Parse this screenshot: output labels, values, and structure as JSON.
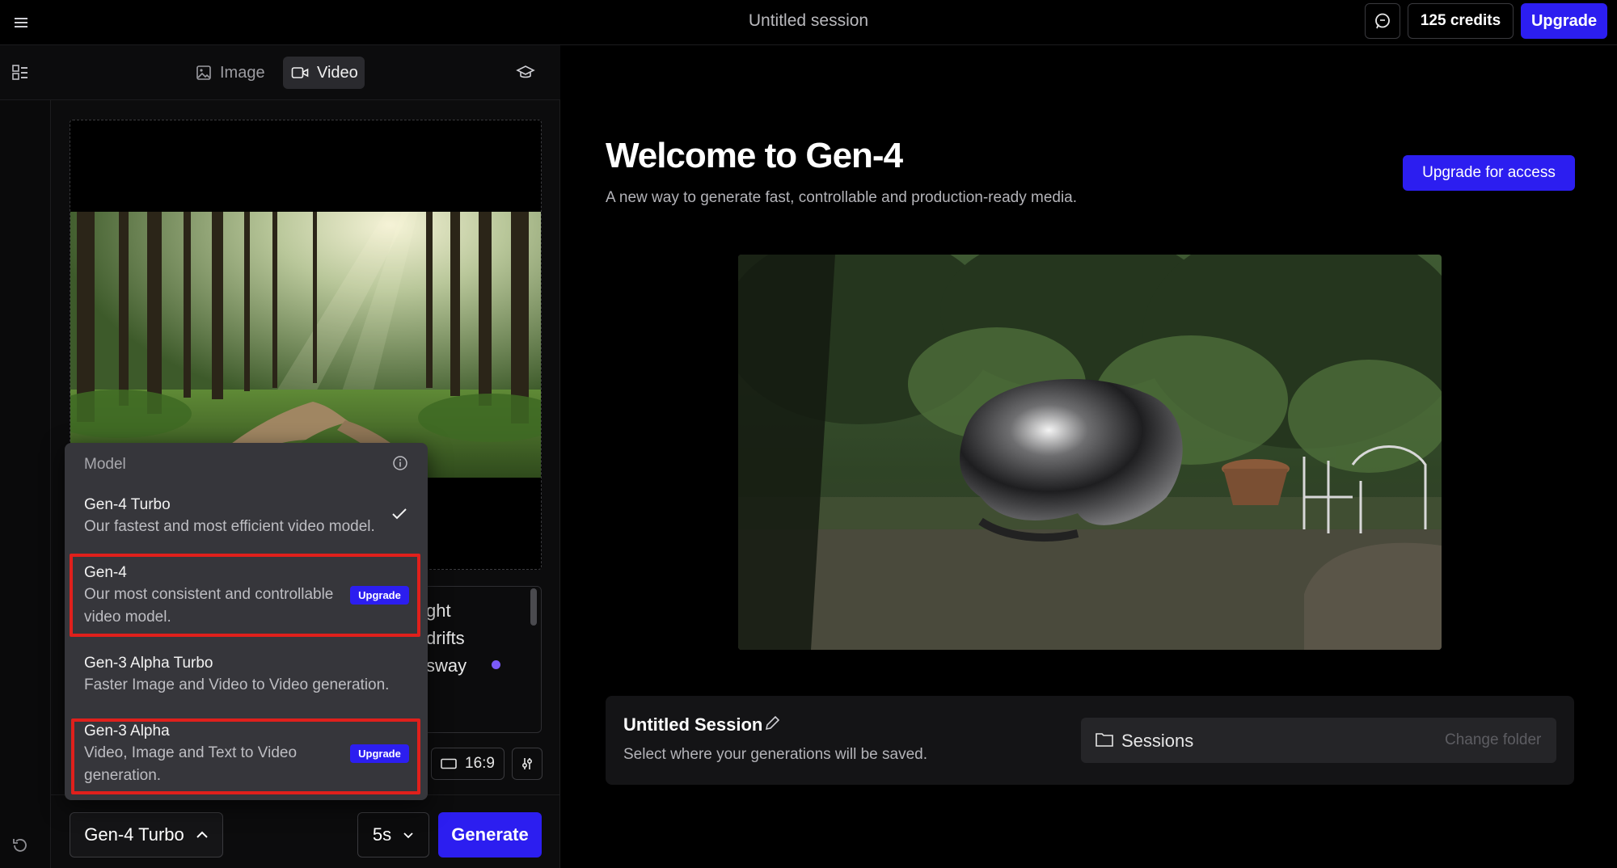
{
  "header": {
    "title": "Untitled session",
    "credits_label": "125 credits",
    "upgrade_label": "Upgrade"
  },
  "mode_tabs": [
    {
      "label": "Image",
      "active": false,
      "icon": "image-icon"
    },
    {
      "label": "Video",
      "active": true,
      "icon": "video-camera-icon"
    }
  ],
  "prompt": {
    "visible_lines": [
      "ght",
      "drifts",
      "sway"
    ]
  },
  "controls": {
    "aspect_ratio": "16:9",
    "model_button_label": "Gen-4 Turbo",
    "duration_label": "5s",
    "generate_label": "Generate"
  },
  "model_menu": {
    "header": "Model",
    "options": [
      {
        "title": "Gen-4 Turbo",
        "description": "Our fastest and most efficient video model.",
        "selected": true,
        "badge": ""
      },
      {
        "title": "Gen-4",
        "description_lines": [
          "Our most consistent and controllable",
          "video model."
        ],
        "selected": false,
        "badge": "Upgrade"
      },
      {
        "title": "Gen-3 Alpha Turbo",
        "description": "Faster Image and Video to Video generation.",
        "selected": false,
        "badge": ""
      },
      {
        "title": "Gen-3 Alpha",
        "description_lines": [
          "Video, Image and Text to Video",
          "generation."
        ],
        "selected": false,
        "badge": "Upgrade"
      }
    ]
  },
  "welcome": {
    "title": "Welcome to Gen-4",
    "subtitle": "A new way to generate fast, controllable and production-ready media.",
    "upgrade_access_label": "Upgrade for access"
  },
  "session_card": {
    "name": "Untitled Session",
    "subtitle": "Select where your generations will be saved.",
    "folder_name": "Sessions",
    "change_folder_label": "Change folder"
  },
  "colors": {
    "accent": "#2c1ef0",
    "highlight": "#e0201c",
    "background": "#000000"
  }
}
